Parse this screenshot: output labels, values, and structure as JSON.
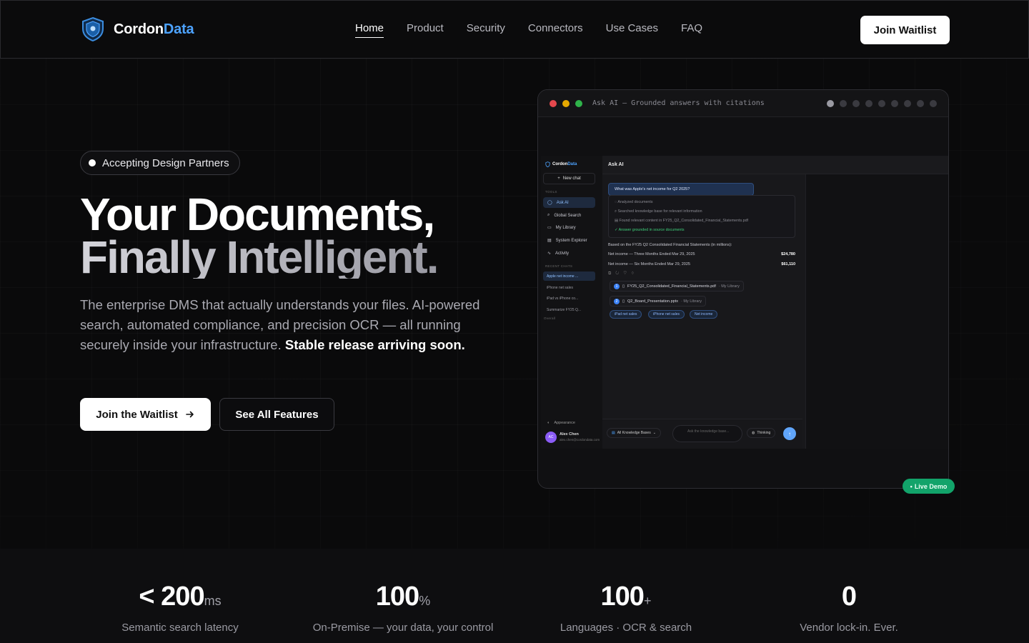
{
  "brand": {
    "name_part1": "Cordon",
    "name_part2": "Data",
    "accent": "#4da3ff"
  },
  "nav": {
    "items": [
      "Home",
      "Product",
      "Security",
      "Connectors",
      "Use Cases",
      "FAQ"
    ],
    "active": "Home"
  },
  "header": {
    "cta_label": "Join Waitlist"
  },
  "hero": {
    "badge": "Accepting Design Partners",
    "title_line1": "Your Documents,",
    "title_line2": "Finally Intelligent.",
    "lead": "The enterprise DMS that actually understands your files. AI-powered search, automated compliance, and precision OCR — all running securely inside your infrastructure.",
    "lead_strong": "Stable release arriving soon.",
    "primary_cta": "Join the Waitlist",
    "secondary_cta": "See All Features"
  },
  "demo": {
    "title": "Ask AI — Grounded answers with citations",
    "slide_count": 9,
    "active_slide": 1,
    "live_badge": "Live Demo",
    "app": {
      "brand_part1": "Cordon",
      "brand_part2": "Data",
      "new_chat": "New chat",
      "tools_label": "TOOLS",
      "tools": [
        "Ask AI",
        "Global Search",
        "My Library",
        "System Explorer",
        "Activity"
      ],
      "recent_label": "RECENT CHATS",
      "recent": [
        "Apple net income ...",
        "iPhone net sales",
        "iPad vs iPhone co...",
        "Summarize FY25 Q..."
      ],
      "recent_more": "Overall",
      "header": "Ask AI",
      "question": "What was Apple's net income for Q2 2025?",
      "steps": [
        "Analyzed documents",
        "Searched knowledge base for relevant information",
        "Found relevant content in FY25_Q2_Consolidated_Financial_Statements.pdf",
        "Answer grounded in source documents"
      ],
      "answer_intro": "Based on the FY25 Q2 Consolidated Financial Statements (in millions):",
      "rows": [
        {
          "label": "Net income — Three Months Ended Mar 29, 2025",
          "value": "$24,780"
        },
        {
          "label": "Net income — Six Months Ended Mar 29, 2025",
          "value": "$61,110"
        }
      ],
      "citations": [
        {
          "n": "1",
          "file": "FY25_Q2_Consolidated_Financial_Statements.pdf",
          "src": "· My Library"
        },
        {
          "n": "2",
          "file": "Q2_Board_Presentation.pptx",
          "src": "· My Library"
        }
      ],
      "chips": [
        "iPad net sales",
        "iPhone net sales",
        "Net income"
      ],
      "appearance": "Appearance",
      "user_name": "Alex Chen",
      "user_email": "alex.chen@cordondata.com",
      "user_initials": "AC",
      "kb_select": "All Knowledge Bases",
      "input_placeholder": "Ask the knowledge base...",
      "thinking": "Thinking"
    }
  },
  "stats": [
    {
      "value": "< 200",
      "unit": "ms",
      "label": "Semantic search latency"
    },
    {
      "value": "100",
      "unit": "%",
      "label": "On-Premise — your data, your control"
    },
    {
      "value": "100",
      "unit": "+",
      "label": "Languages · OCR & search"
    },
    {
      "value": "0",
      "unit": "",
      "label": "Vendor lock-in. Ever."
    }
  ]
}
